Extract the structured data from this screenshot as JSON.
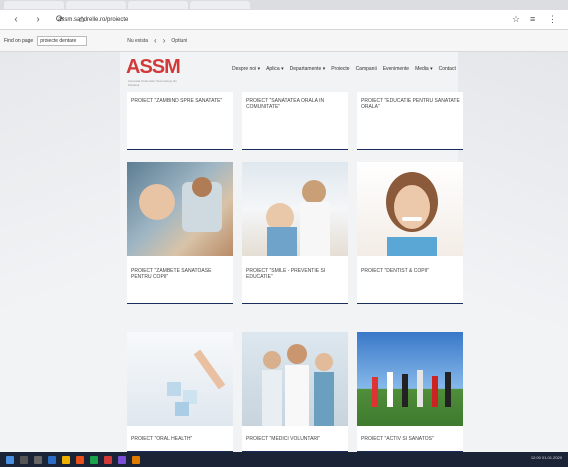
{
  "browser": {
    "url": "assm.sandrelle.ro/proiecte",
    "back": "‹",
    "forward": "›",
    "reload": "⟳",
    "home": "⌂",
    "star": "☆",
    "ext1": "≡",
    "ext2": "⋮"
  },
  "findbar": {
    "label": "Find on page",
    "value": "proiecte dentare",
    "option": "Nu exista",
    "prev": "‹",
    "next": "›",
    "close": "Optiuni"
  },
  "site": {
    "logo": "ASSM",
    "logo_tagline": "Asociatia Studentilor Stomatologi din Moldova",
    "menu": [
      "Despre noi ▾",
      "Aplica ▾",
      "Departamente ▾",
      "Proiecte",
      "Campanii",
      "Evenimente",
      "Media ▾",
      "Contact"
    ]
  },
  "cards": [
    {
      "caption": "PROIECT \"ZAMBIND SPRE SANATATE\""
    },
    {
      "caption": "PROIECT \"SANATATEA ORALA IN COMUNITATE\""
    },
    {
      "caption": "PROIECT \"EDUCATIE PENTRU SANATATE ORALA\""
    },
    {
      "caption": "PROIECT \"ZAMBETE SANATOASE PENTRU COPII\""
    },
    {
      "caption": "PROIECT \"SMILE - PREVENTIE SI EDUCATIE\""
    },
    {
      "caption": "PROIECT \"DENTIST & COPII\""
    },
    {
      "caption": "PROIECT \"ORAL HEALTH\""
    },
    {
      "caption": "PROIECT \"MEDICI VOLUNTARI\""
    },
    {
      "caption": "PROIECT \"ACTIV SI SANATOS\""
    }
  ],
  "tray": {
    "time": "12:00",
    "date": "01.01.2020"
  },
  "colors": {
    "accent": "#d23a3a",
    "card_border": "#1b2d5c"
  }
}
